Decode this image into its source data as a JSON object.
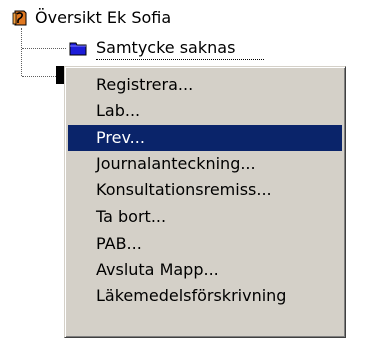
{
  "tree": {
    "root": {
      "label": "Översikt Ek Sofia",
      "icon": "patient-record-icon"
    },
    "child": {
      "label": "Samtycke saknas",
      "icon": "folder-icon"
    }
  },
  "context_menu": {
    "items": [
      {
        "label": "Registrera..."
      },
      {
        "label": "Lab..."
      },
      {
        "label": "Prev..."
      },
      {
        "label": "Journalanteckning..."
      },
      {
        "label": "Konsultationsremiss..."
      },
      {
        "label": "Ta bort..."
      },
      {
        "label": "PAB..."
      },
      {
        "label": "Avsluta Mapp..."
      },
      {
        "label": "Läkemedelsförskrivning"
      }
    ],
    "highlighted_index": 2
  },
  "colors": {
    "menu_background": "#d4d0c8",
    "highlight": "#0a246a",
    "folder": "#1c1cd8"
  }
}
